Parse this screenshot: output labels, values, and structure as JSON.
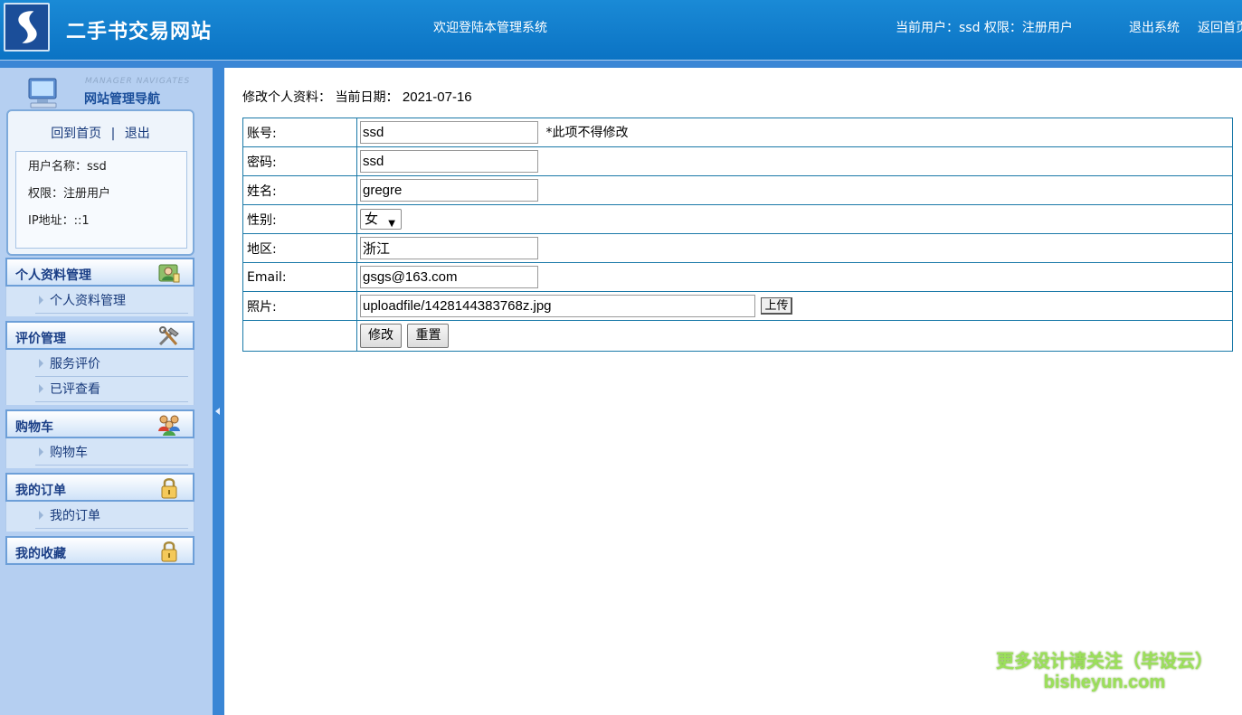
{
  "header": {
    "site_title": "二手书交易网站",
    "welcome": "欢迎登陆本管理系统",
    "current_user": "当前用户：ssd 权限：注册用户",
    "logout": "退出系统",
    "home": "返回首页"
  },
  "sidebar": {
    "nav_en": "MANAGER NAVIGATES",
    "nav_cn": "网站管理导航",
    "home_link": "回到首页",
    "separator": "|",
    "exit_link": "退出",
    "username": "用户名称：ssd",
    "role": "权限：注册用户",
    "ip": "IP地址：::1",
    "sections": [
      {
        "title": "个人资料管理",
        "icon": "user-edit-icon",
        "items": [
          "个人资料管理"
        ]
      },
      {
        "title": "评价管理",
        "icon": "tools-icon",
        "items": [
          "服务评价",
          "已评查看"
        ]
      },
      {
        "title": "购物车",
        "icon": "group-icon",
        "items": [
          "购物车"
        ]
      },
      {
        "title": "我的订单",
        "icon": "lock-icon",
        "items": [
          "我的订单"
        ]
      },
      {
        "title": "我的收藏",
        "icon": "lock-icon",
        "items": []
      }
    ]
  },
  "main": {
    "crumb_label": "修改个人资料：  当前日期：",
    "date": "2021-07-16",
    "form": {
      "account_label": "账号:",
      "account_value": "ssd",
      "account_note": "*此项不得修改",
      "password_label": "密码:",
      "password_value": "ssd",
      "name_label": "姓名:",
      "name_value": "gregre",
      "gender_label": "性别:",
      "gender_value": "女",
      "region_label": "地区:",
      "region_value": "浙江",
      "email_label": "Email:",
      "email_value": "gsgs@163.com",
      "photo_label": "照片:",
      "photo_value": "uploadfile/1428144383768z.jpg",
      "upload_button": "上传",
      "submit_button": "修改",
      "reset_button": "重置"
    }
  },
  "watermark": {
    "line1": "更多设计请关注（毕设云）",
    "line2": "bisheyun.com"
  }
}
